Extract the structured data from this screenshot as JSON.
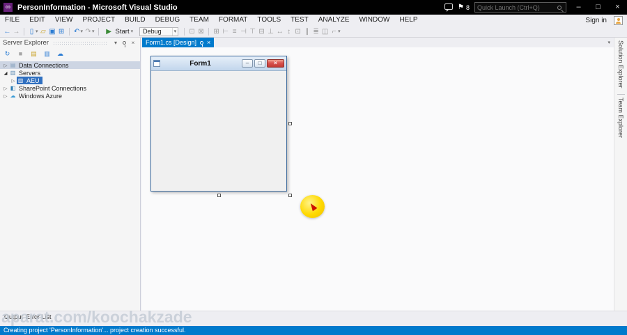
{
  "titlebar": {
    "title": "PersonInformation - Microsoft Visual Studio",
    "notification_count": "8",
    "quick_launch_placeholder": "Quick Launch (Ctrl+Q)"
  },
  "menubar": {
    "items": [
      "FILE",
      "EDIT",
      "VIEW",
      "PROJECT",
      "BUILD",
      "DEBUG",
      "TEAM",
      "FORMAT",
      "TOOLS",
      "TEST",
      "ANALYZE",
      "WINDOW",
      "HELP"
    ],
    "sign_in_label": "Sign in"
  },
  "toolbar": {
    "start_label": "Start",
    "configuration": "Debug"
  },
  "server_explorer": {
    "title": "Server Explorer",
    "tree": [
      {
        "label": "Data Connections"
      },
      {
        "label": "Servers"
      },
      {
        "label": "AEU"
      },
      {
        "label": "SharePoint Connections"
      },
      {
        "label": "Windows Azure"
      }
    ]
  },
  "editor": {
    "tab": "Form1.cs [Design]",
    "form_title": "Form1"
  },
  "right_panel_tabs": {
    "solution_explorer": "Solution Explorer",
    "team_explorer": "Team Explorer"
  },
  "bottom_tabs": {
    "output": "Output",
    "error_list": "Error List"
  },
  "statusbar": {
    "message": "Creating project 'PersonInformation'... project creation successful."
  },
  "watermark": "aparat.com/koochakzade",
  "accent_colors": {
    "statusbar_blue": "#007ACC",
    "active_tab_blue": "#007ACC",
    "selection_blue": "#3070C0",
    "vs_logo_purple": "#68217A",
    "highlight_yellow": "#FFD900",
    "close_button_red": "#C23B35"
  },
  "icons": {
    "vs_logo": "∞",
    "flag": "⚑",
    "minimize": "–",
    "restore": "□",
    "close": "×",
    "nav_back": "←",
    "nav_forward": "→",
    "new_file": "▯",
    "open_file": "▱",
    "save": "▣",
    "save_all": "⊞",
    "undo": "↶",
    "redo": "↷",
    "start_arrow": "▶",
    "dropdown": "▾",
    "processes": "⊡",
    "find": "⊠",
    "refresh": "↻",
    "stop": "■",
    "database": "▤",
    "server": "▥",
    "sharepoint": "◧",
    "cloud": "☁",
    "tree_collapsed": "▷",
    "tree_expanded": "◢",
    "tab_close": "×",
    "panel_close": "×",
    "format_icons": [
      "⊞",
      "⊢",
      "≡",
      "⊣",
      "⊤",
      "⊟",
      "⊥",
      "↔",
      "↕",
      "⊡",
      "∥",
      "≣",
      "◫",
      "⌐"
    ]
  }
}
